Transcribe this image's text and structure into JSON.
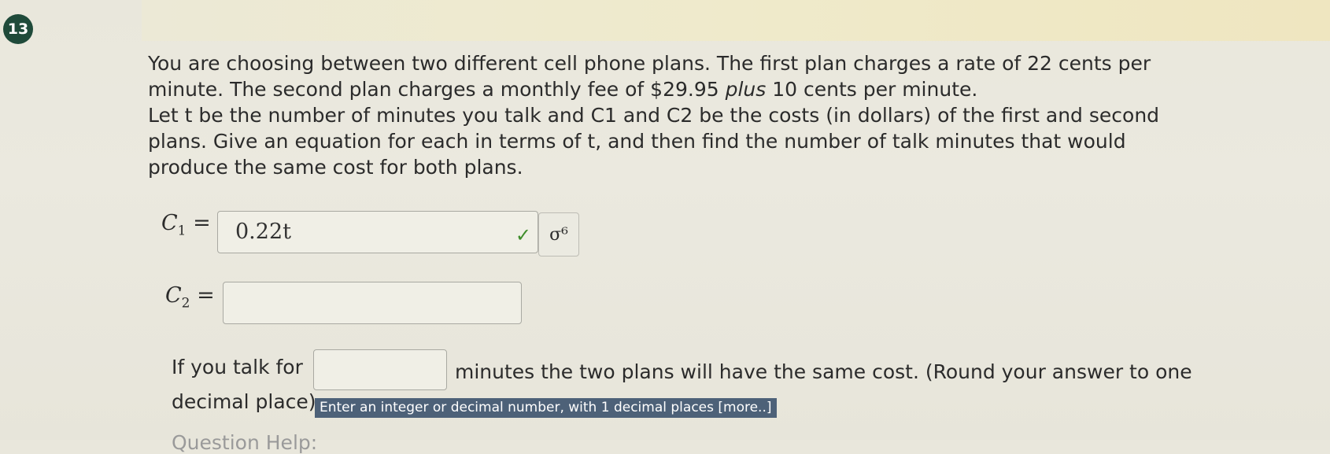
{
  "question_number": "13",
  "prompt": {
    "line1": "You are choosing between two different cell phone plans. The first plan charges a rate of 22 cents per",
    "line2_a": "minute. The second plan charges a monthly fee of $29.95 ",
    "line2_b": "plus",
    "line2_c": " 10 cents per minute.",
    "line3": "Let t be the number of minutes you talk and C1 and C2 be the costs (in dollars) of the first and second",
    "line4": "plans. Give an equation for each in terms of t, and then find the number of talk minutes that would",
    "line5": "produce the same cost for both plans."
  },
  "c1": {
    "label": "C",
    "sub": "1",
    "eq": "=",
    "value": "0.22t",
    "status": "correct"
  },
  "c2": {
    "label": "C",
    "sub": "2",
    "eq": "=",
    "value": ""
  },
  "symbol_button": "σ⁶",
  "final": {
    "before": "If you talk for",
    "after": "minutes the two plans will have the same cost. (Round your answer to one",
    "line2": "decimal place)",
    "value": ""
  },
  "hint": "Enter an integer or decimal number, with 1 decimal places [more..]",
  "footer_cut": "Question Help:"
}
